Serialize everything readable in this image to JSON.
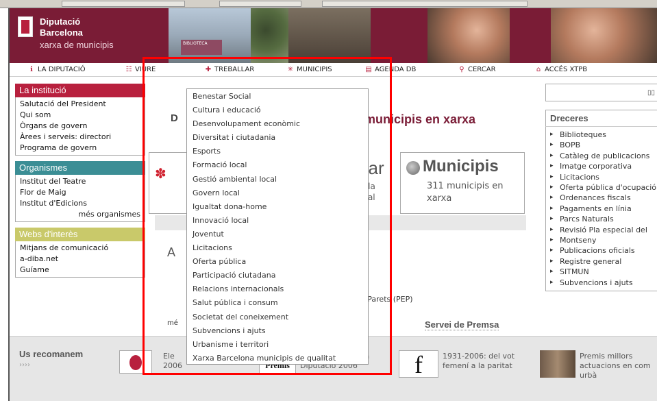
{
  "header": {
    "brand_line1": "Diputació",
    "brand_line2": "Barcelona",
    "brand_line3": "xarxa de municipis",
    "photo_sign": "BIBLIOTECA"
  },
  "nav": [
    {
      "icon": "info-icon",
      "glyph": "ℹ",
      "label": "LA DIPUTACIÓ"
    },
    {
      "icon": "people-icon",
      "glyph": "☷",
      "label": "VIURE"
    },
    {
      "icon": "cross-icon",
      "glyph": "✚",
      "label": "TREBALLAR"
    },
    {
      "icon": "star-icon",
      "glyph": "✳",
      "label": "MUNICIPIS"
    },
    {
      "icon": "book-icon",
      "glyph": "▤",
      "label": "AGENDA DB"
    },
    {
      "icon": "magnifier-icon",
      "glyph": "⚲",
      "label": "CERCAR"
    },
    {
      "icon": "lock-icon",
      "glyph": "⌂",
      "label": "ACCÉS XTPB"
    }
  ],
  "left": {
    "institucio": {
      "title": "La institució",
      "items": [
        "Salutació del President",
        "Qui som",
        "Òrgans de govern",
        "Àrees i serveis: directori",
        "Programa de govern"
      ]
    },
    "organismes": {
      "title": "Organismes",
      "items": [
        "Institut del Teatre",
        "Flor de Maig",
        "Institut d'Edicions"
      ],
      "more": "més organismes"
    },
    "webs": {
      "title": "Webs d'interès",
      "items": [
        "Mitjans de comunicació",
        "a-diba.net",
        "Guíame"
      ]
    }
  },
  "center": {
    "title_left": "D",
    "title_right": "municipis en xarxa",
    "treballar_label": "llar",
    "treballar_desc_1": "a la",
    "treballar_desc_2": "ipal",
    "municipis_label": "Municipis",
    "municipis_desc": "311 municipis en xarxa",
    "a_label": "A",
    "misc_text": "e Parets (PEP)",
    "misc_text2": "mé",
    "premsa": "Servei de Premsa"
  },
  "right": {
    "dreceres_title": "Dreceres",
    "search_glyph": "▯▯",
    "items": [
      "Biblioteques",
      "BOPB",
      "Catàleg de publicacions",
      "Imatge corporativa",
      "Licitacions",
      "Oferta pública d'ocupació",
      "Ordenances fiscals",
      "Pagaments en línia",
      "Parcs Naturals",
      "Revisió Pla especial del",
      "Montseny",
      "Publicacions oficials",
      "Registre general",
      "SITMUN",
      "Subvencions i ajuts"
    ]
  },
  "footer": {
    "title": "Us recomanem",
    "arrows": "››››",
    "item1": "Ele\n2006",
    "item2_thumb": "Premis",
    "item2": "Comunicació de la\nDiputació 2006",
    "item3_thumb": "f",
    "item3": "1931-2006: del vot\nfemení a la paritat",
    "item4": "Premis millors\nactuacions en com\nurbà"
  },
  "dropdown": {
    "items": [
      "Benestar Social",
      "Cultura i educació",
      "Desenvolupament econòmic",
      "Diversitat i ciutadania",
      "Esports",
      "Formació local",
      "Gestió ambiental local",
      "Govern local",
      "Igualtat dona-home",
      "Innovació local",
      "Joventut",
      "Licitacions",
      "Oferta pública",
      "Participació ciutadana",
      "Relacions internacionals",
      "Salut pública i consum",
      "Societat del coneixement",
      "Subvencions i ajuts",
      "Urbanisme i territori",
      "Xarxa Barcelona municipis de qualitat"
    ]
  }
}
